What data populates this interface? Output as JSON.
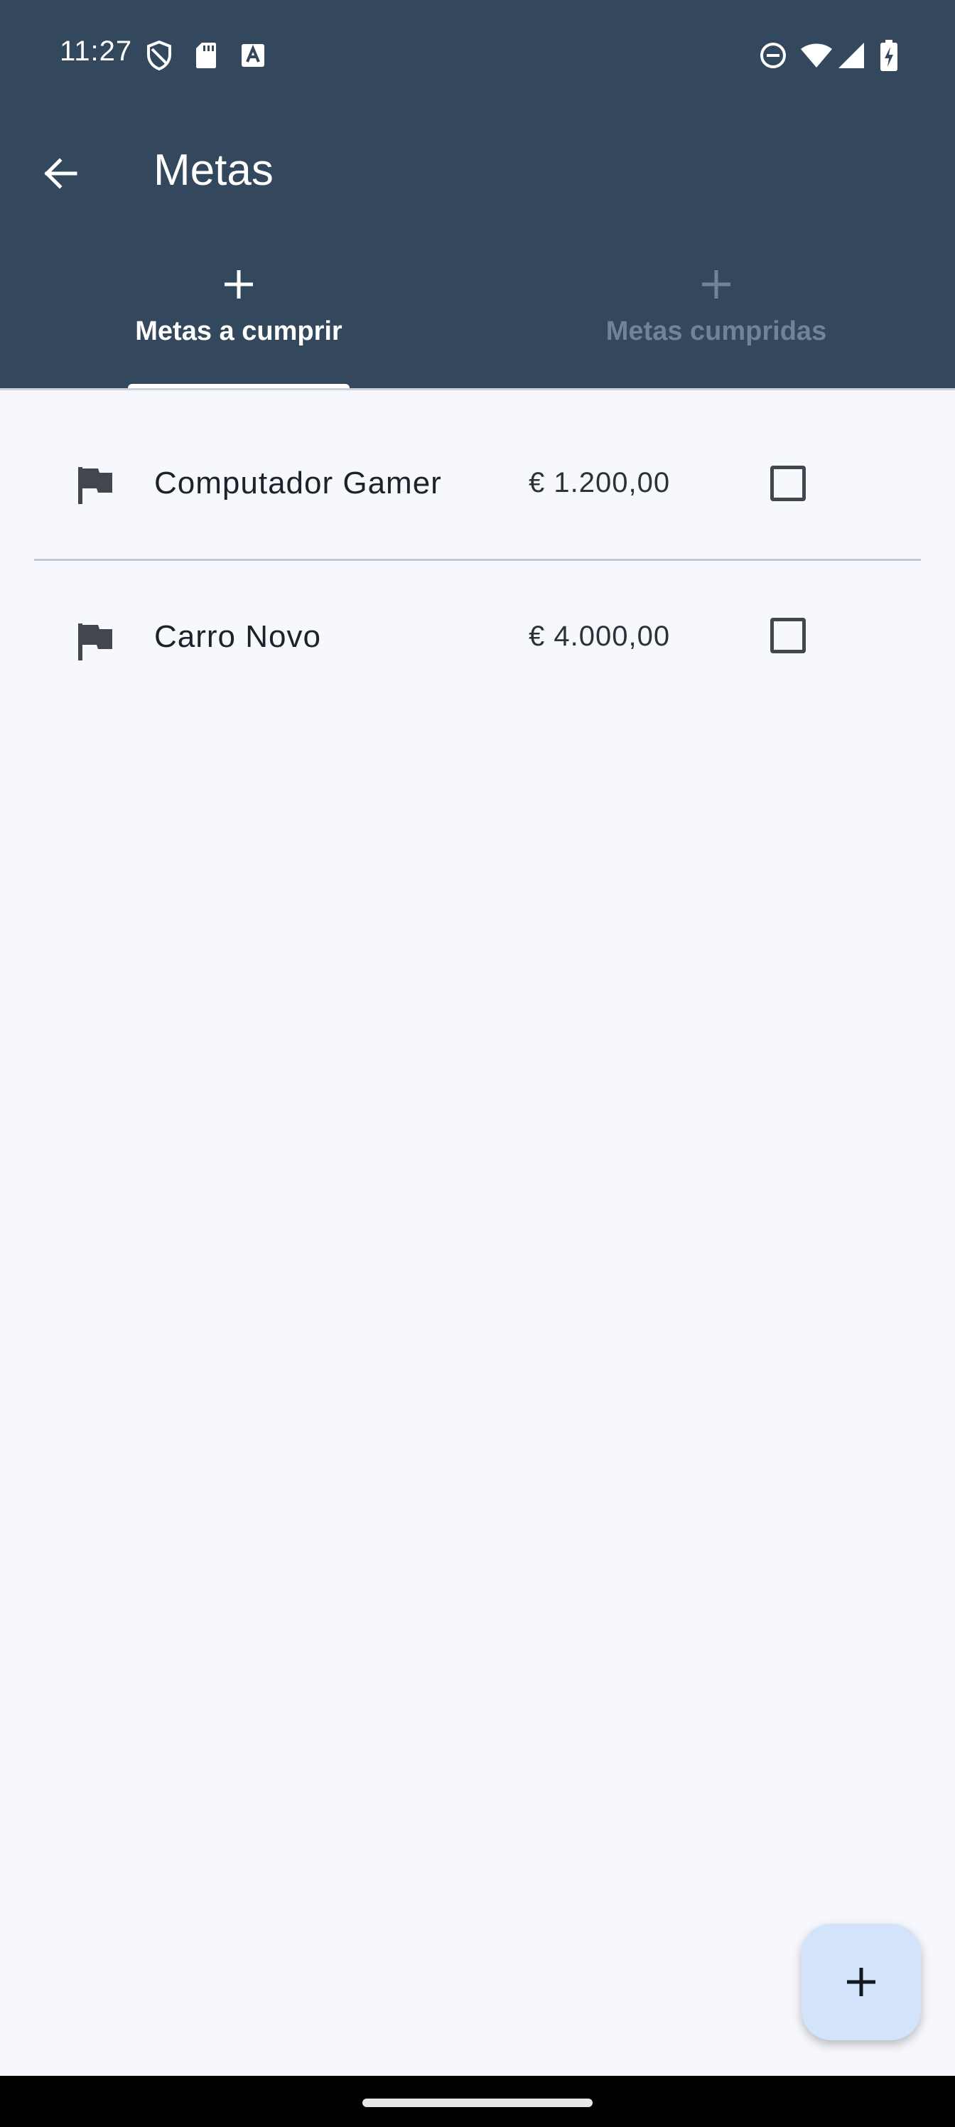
{
  "status_bar": {
    "time": "11:27"
  },
  "app_bar": {
    "title": "Metas",
    "back_icon": "arrow-back-icon"
  },
  "tabs": [
    {
      "label": "Metas a cumprir",
      "icon": "plus-icon",
      "selected": true
    },
    {
      "label": "Metas cumpridas",
      "icon": "plus-icon",
      "selected": false
    }
  ],
  "goals": [
    {
      "name": "Computador Gamer",
      "value": "€ 1.200,00",
      "checked": false,
      "icon": "flag-icon"
    },
    {
      "name": "Carro Novo",
      "value": "€ 4.000,00",
      "checked": false,
      "icon": "flag-icon"
    }
  ],
  "fab": {
    "icon": "plus-icon"
  },
  "colors": {
    "app_bar": "#33475d",
    "background": "#f6f8fd",
    "fab": "#d3e4fa",
    "tab_inactive": "#6f8496"
  }
}
